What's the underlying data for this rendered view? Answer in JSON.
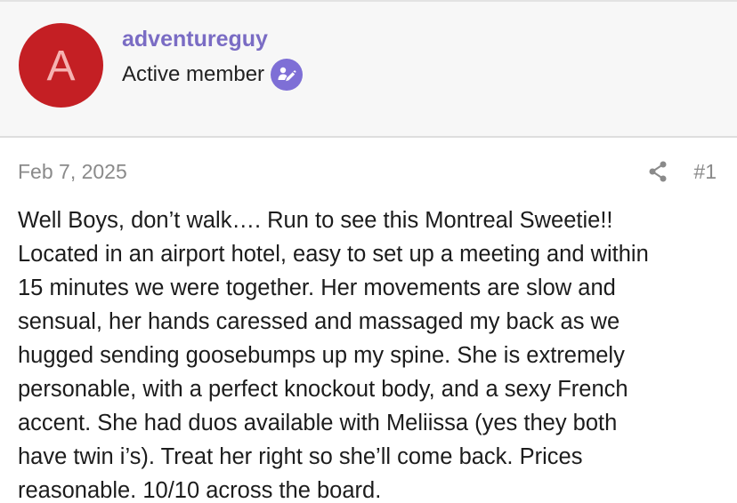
{
  "author": {
    "avatar_letter": "A",
    "avatar_color": "#c41f24",
    "username": "adventureguy",
    "username_color": "#7a6cc4",
    "member_title": "Active member",
    "badge_icon": "verified-badge-icon"
  },
  "meta": {
    "date": "Feb 7, 2025",
    "share_icon": "share-icon",
    "post_number": "#1"
  },
  "body": {
    "text": "Well Boys, don’t walk…. Run to see this Montreal Sweetie!!\nLocated in an airport hotel, easy to set up a meeting and within\n15 minutes we were together. Her movements are slow and\nsensual, her hands caressed and massaged my back as we\nhugged sending goosebumps up my spine. She is extremely\npersonable, with a perfect knockout body, and a sexy French\naccent. She had duos available with Meliissa (yes they both\nhave twin i’s). Treat her right so she’ll come back. Prices\nreasonable. 10/10 across the board."
  }
}
